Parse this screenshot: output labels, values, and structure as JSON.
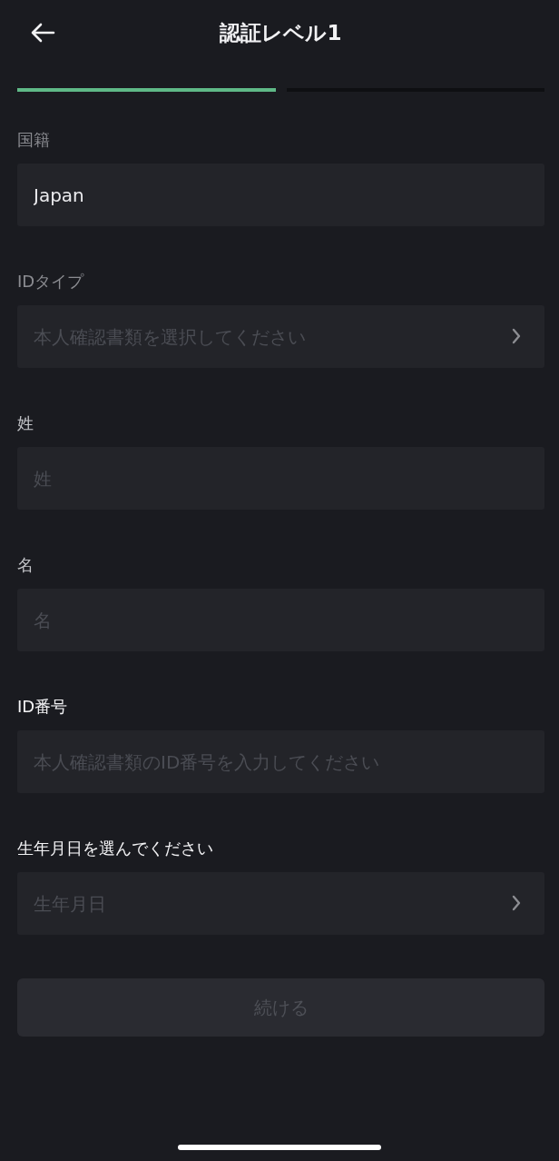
{
  "header": {
    "title": "認証レベル1"
  },
  "steps": [
    {
      "completed": true
    },
    {
      "completed": false
    }
  ],
  "fields": [
    {
      "label": {
        "text": "国籍",
        "kind": "muted"
      },
      "kind": "text",
      "value": "Japan"
    },
    {
      "label": {
        "text": "IDタイプ",
        "kind": "muted"
      },
      "kind": "select",
      "placeholder": "本人確認書類を選択してください"
    },
    {
      "label": {
        "text": "姓",
        "kind": "normal"
      },
      "kind": "text",
      "placeholder": "姓"
    },
    {
      "label": {
        "text": "名",
        "kind": "normal"
      },
      "kind": "text",
      "placeholder": "名"
    },
    {
      "label": {
        "text": "ID番号",
        "kind": "strong"
      },
      "kind": "text",
      "placeholder": "本人確認書類のID番号を入力してください"
    },
    {
      "label": {
        "text": "生年月日を選んでください",
        "kind": "strong"
      },
      "kind": "select",
      "placeholder": "生年月日"
    }
  ],
  "submit": {
    "label": "続ける",
    "disabled": true
  }
}
